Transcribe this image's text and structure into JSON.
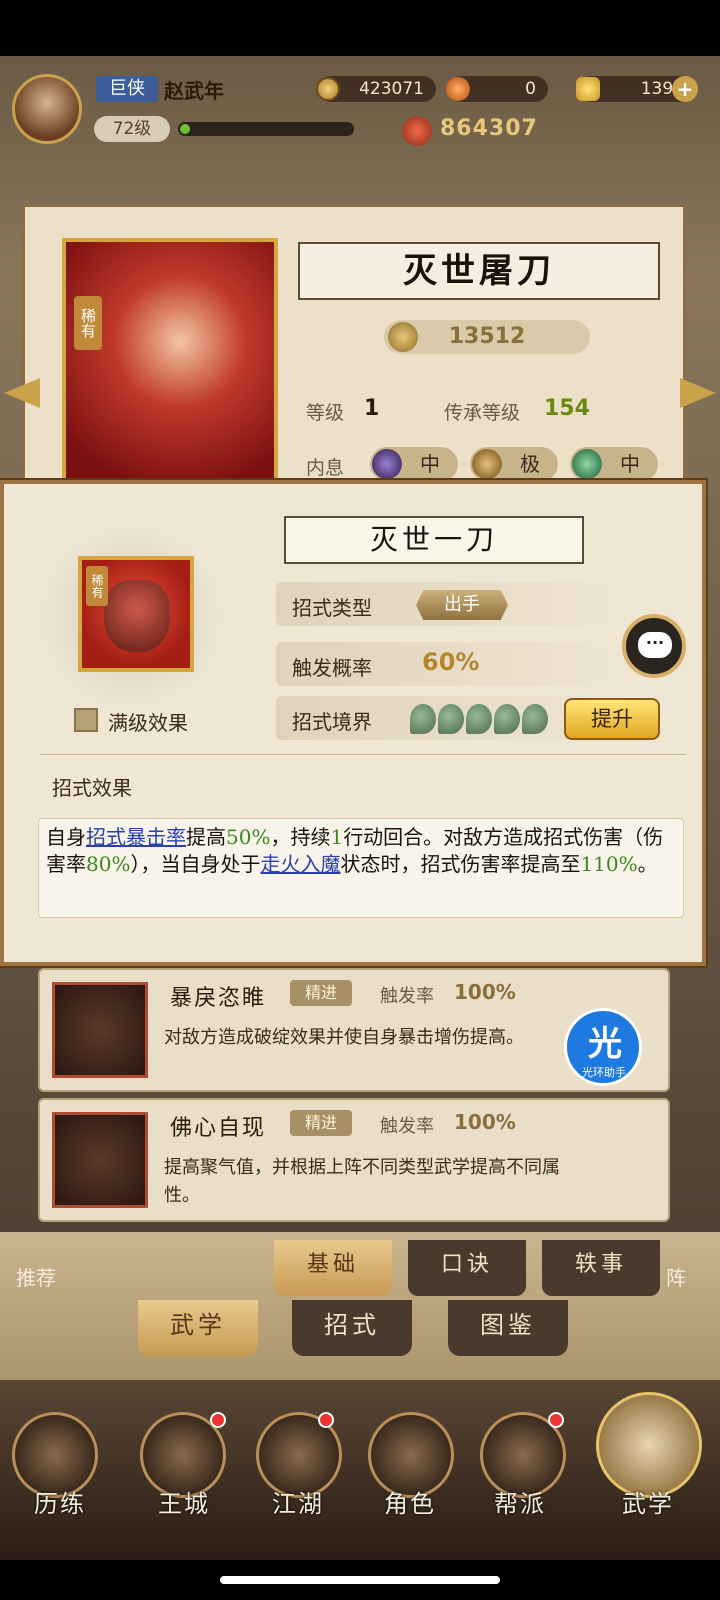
{
  "header": {
    "title_badge": "巨侠",
    "player_name": "赵武年",
    "coins": "423071",
    "gems": "0",
    "gold": "1393",
    "level": "72级",
    "power": "864307"
  },
  "weapon": {
    "name": "灭世屠刀",
    "rarity": "稀有",
    "power": "13512",
    "level_label": "等级",
    "level_value": "1",
    "inherit_label": "传承等级",
    "inherit_value": "154",
    "inner_label": "内息",
    "inner_grades": [
      "中",
      "极",
      "中"
    ]
  },
  "skill_popup": {
    "name": "灭世一刀",
    "rarity": "稀有",
    "max_effect_label": "满级效果",
    "type_label": "招式类型",
    "type_value": "出手",
    "rate_label": "触发概率",
    "rate_value": "60%",
    "realm_label": "招式境界",
    "realm_level": 5,
    "upgrade_label": "提升",
    "chat_label": "···",
    "effect_heading": "招式效果",
    "effect": {
      "p1": "自身",
      "link1": "招式暴击率",
      "p2": "提高",
      "v1": "50%",
      "p3": "，持续",
      "v2": "1",
      "p4": "行动回合。对敌方造成招式伤害（伤害率",
      "v3": "80%",
      "p5": "），当自身处于",
      "link2": "走火入魔",
      "p6": "状态时，招式伤害率提高至",
      "v4": "110%",
      "p7": "。"
    }
  },
  "skills": [
    {
      "name": "暴戾恣睢",
      "tag": "精进",
      "rate_label": "触发率",
      "rate_value": "100%",
      "desc": "对敌方造成破绽效果并使自身暴击增伤提高。"
    },
    {
      "name": "佛心自现",
      "tag": "精进",
      "rate_label": "触发率",
      "rate_value": "100%",
      "desc": "提高聚气值，并根据上阵不同类型武学提高不同属性。"
    }
  ],
  "helper": {
    "glyph": "光",
    "label": "光环助手"
  },
  "subtabs": {
    "left_label": "推荐",
    "right_label": "阵",
    "items": [
      "基础",
      "口诀",
      "轶事"
    ],
    "active": "基础"
  },
  "maintabs": {
    "items": [
      "武学",
      "招式",
      "图鉴"
    ],
    "active": "武学"
  },
  "nav": {
    "items": [
      "历练",
      "王城",
      "江湖",
      "角色",
      "帮派",
      "武学"
    ]
  }
}
